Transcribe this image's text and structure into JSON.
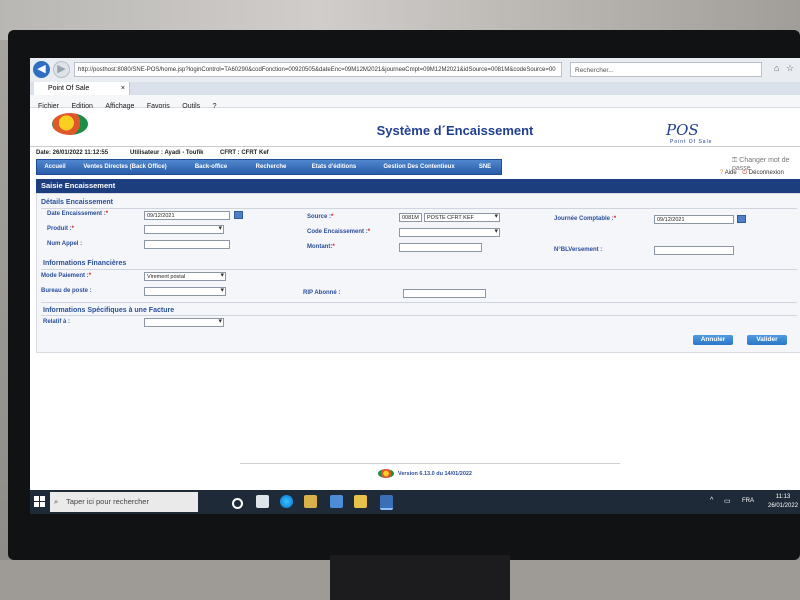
{
  "browser": {
    "url": "http://posthost:8080/SNE-POS/home.jsp?loginControl=TA60290&codFonction=00920505&dateEnc=09M12M2021&journeeCmpt=09M12M2021&idSource=0081M&codeSource=00",
    "search_placeholder": "Rechercher...",
    "tab_title": "Point Of Sale",
    "menu": [
      "Fichier",
      "Edition",
      "Affichage",
      "Favoris",
      "Outils",
      "?"
    ]
  },
  "header": {
    "title": "Système d´Encaissement",
    "brand": "POS",
    "brand_sub": "Point Of Sale",
    "date": "Date: 26/01/2022 11:12:55",
    "user": "Utilisateur : Ayadi - Toufik",
    "center": "CFRT : CFRT Kef",
    "change_password": "Changer mot de passe",
    "help": "Aide",
    "logout": "Déconnexion"
  },
  "nav": {
    "tabs": [
      "Accueil",
      "Ventes Directes (Back Office)",
      "Back-office",
      "Recherche",
      "Etats d'éditions",
      "Gestion Des Contentieux",
      "SNE"
    ]
  },
  "form": {
    "title": "Saisie Encaissement",
    "details": {
      "title": "Détails Encaissement",
      "date_label": "Date Encaissement :",
      "date_value": "09/12/2021",
      "produit_label": "Produit :",
      "num_appel_label": "Num Appel :",
      "source_label": "Source :",
      "source_code": "0081M",
      "source_name": "POSTE CFRT KEF",
      "code_enc_label": "Code Encaissement :",
      "montant_label": "Montant:",
      "journee_label": "Journée Comptable :",
      "journee_value": "09/12/2021",
      "versement_label": "N°BLVersement :"
    },
    "finance": {
      "title": "Informations Financières",
      "mode_label": "Mode Paiement :",
      "mode_value": "Virement postal",
      "bureau_label": "Bureau de poste :",
      "rip_label": "RIP Abonné :"
    },
    "facture": {
      "title": "Informations Spécifiques à une Facture",
      "relatif_label": "Relatif à :"
    },
    "buttons": {
      "cancel": "Annuler",
      "validate": "Valider"
    }
  },
  "footer": {
    "version": "Version 6.13.0 du 14/01/2022"
  },
  "taskbar": {
    "search_placeholder": "Taper ici pour rechercher",
    "language": "FRA",
    "time": "11:13",
    "date": "26/01/2022"
  },
  "colors": {
    "primary": "#1c3e7e",
    "accent": "#2b76c6",
    "label": "#2a4f9a"
  }
}
